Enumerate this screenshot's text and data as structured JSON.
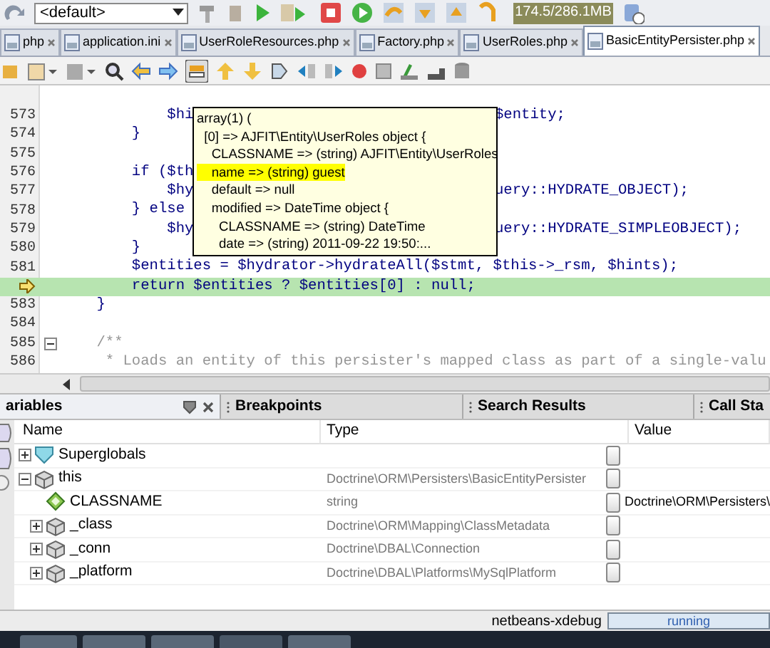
{
  "toolbar": {
    "config": "<default>",
    "memory": "174.5/286.1MB"
  },
  "tabs": [
    {
      "label": "php",
      "selected": false
    },
    {
      "label": "application.ini",
      "selected": false
    },
    {
      "label": "UserRoleResources.php",
      "selected": false
    },
    {
      "label": "Factory.php",
      "selected": false
    },
    {
      "label": "UserRoles.php",
      "selected": false
    },
    {
      "label": "BasicEntityPersister.php",
      "selected": true
    }
  ],
  "editor": {
    "lines": [
      {
        "number": "573",
        "kind": "code",
        "left": "            $hi",
        "right": "$entity;",
        "current": false,
        "foldable": false
      },
      {
        "number": "574",
        "kind": "code",
        "left": "        }",
        "current": false,
        "foldable": false
      },
      {
        "number": "575",
        "kind": "code",
        "current": false,
        "foldable": false
      },
      {
        "number": "576",
        "kind": "code",
        "left": "        if ($th",
        "current": false,
        "foldable": false
      },
      {
        "number": "577",
        "kind": "code",
        "left": "            $hy",
        "right": "uery::HYDRATE_OBJECT);",
        "current": false,
        "foldable": false
      },
      {
        "number": "578",
        "kind": "code",
        "left": "        } else",
        "current": false,
        "foldable": false
      },
      {
        "number": "579",
        "kind": "code",
        "left": "            $hy",
        "right": "uery::HYDRATE_SIMPLEOBJECT);",
        "current": false,
        "foldable": false
      },
      {
        "number": "580",
        "kind": "code",
        "left": "        }",
        "current": false,
        "foldable": false
      },
      {
        "number": "581",
        "kind": "code",
        "left": "        $entities = $hydrator->hydrateAll($stmt, $this->_rsm, $hints);",
        "current": false,
        "foldable": false
      },
      {
        "kind": "code",
        "left": "        return $entities ? $entities[0] : null;",
        "current": true,
        "foldable": false
      },
      {
        "number": "583",
        "kind": "code",
        "left": "    }",
        "current": false,
        "foldable": false
      },
      {
        "number": "584",
        "kind": "code",
        "current": false,
        "foldable": false
      },
      {
        "number": "585",
        "kind": "comment",
        "left": "    /**",
        "current": false,
        "foldable": true
      },
      {
        "number": "586",
        "kind": "comment",
        "left": "     * Loads an entity of this persister's mapped class as part of a single-valu",
        "current": false,
        "foldable": false
      }
    ],
    "tooltip": [
      {
        "text": "array(1) (",
        "highlighted": false
      },
      {
        "text": "  [0] => AJFIT\\Entity\\UserRoles object {",
        "highlighted": false
      },
      {
        "text": "    CLASSNAME => (string) AJFIT\\Entity\\UserRoles",
        "highlighted": false
      },
      {
        "text": "    name => (string) guest",
        "highlighted": true
      },
      {
        "text": "    default => null",
        "highlighted": false
      },
      {
        "text": "    modified => DateTime object {",
        "highlighted": false
      },
      {
        "text": "      CLASSNAME => (string) DateTime",
        "highlighted": false
      },
      {
        "text": "      date => (string) 2011-09-22 19:50:...",
        "highlighted": false
      }
    ]
  },
  "panel_tabs": [
    {
      "label": "ariables",
      "selected": true
    },
    {
      "label": "Breakpoints",
      "selected": false
    },
    {
      "label": "Search Results",
      "selected": false
    },
    {
      "label": "Call Sta",
      "selected": false
    }
  ],
  "variables": {
    "columns": [
      "Name",
      "Type",
      "Value"
    ],
    "rows": [
      {
        "name": "Superglobals",
        "kind": "group",
        "expanded": false
      },
      {
        "name": "this",
        "kind": "object",
        "type": "Doctrine\\ORM\\Persisters\\BasicEntityPersister",
        "expanded": true,
        "children": [
          {
            "name": "CLASSNAME",
            "kind": "field",
            "type": "string",
            "value": "Doctrine\\ORM\\Persisters\\"
          },
          {
            "name": "_class",
            "kind": "object",
            "type": "Doctrine\\ORM\\Mapping\\ClassMetadata",
            "expanded": false
          },
          {
            "name": "_conn",
            "kind": "object",
            "type": "Doctrine\\DBAL\\Connection",
            "expanded": false
          },
          {
            "name": "_platform",
            "kind": "object",
            "type": "Doctrine\\DBAL\\Platforms\\MySqlPlatform",
            "expanded": false
          }
        ]
      }
    ]
  },
  "status_bar": {
    "session": "netbeans-xdebug",
    "state": "running",
    "level": 1
  }
}
